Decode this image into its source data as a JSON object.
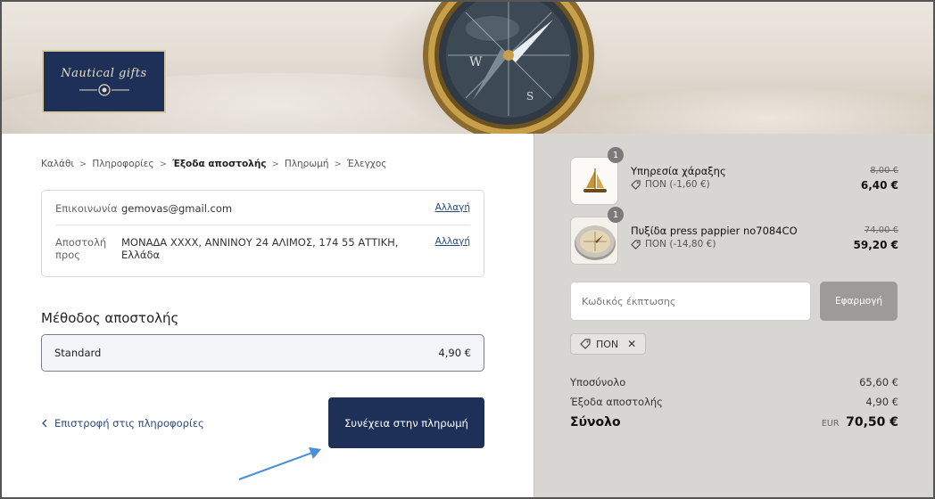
{
  "brand": {
    "logo_text": "Nautical gifts"
  },
  "breadcrumb": {
    "items": [
      "Καλάθι",
      "Πληροφορίες",
      "Έξοδα αποστολής",
      "Πληρωμή",
      "Έλεγχος"
    ],
    "separator": ">",
    "current_index": 2
  },
  "review": {
    "contact": {
      "label": "Επικοινωνία",
      "value": "gemovas@gmail.com",
      "change": "Αλλαγή"
    },
    "ship_to": {
      "label_line1": "Αποστολή",
      "label_line2": "προς",
      "value_line1": "ΜΟΝΑΔΑ ΧΧΧΧ, ΑΝΝΙΝΟΥ 24 ΑΛΙΜΟΣ, 174 55 ΑΤΤΙΚΗ,",
      "value_line2": "Ελλάδα",
      "change": "Αλλαγή"
    }
  },
  "shipping_method": {
    "heading": "Μέθοδος αποστολής",
    "option_name": "Standard",
    "option_price": "4,90 €"
  },
  "nav": {
    "back_label": "Επιστροφή στις πληροφορίες",
    "continue_label": "Συνέχεια στην πληρωμή"
  },
  "summary": {
    "items": [
      {
        "qty": "1",
        "name": "Υπηρεσία χάραξης",
        "discount": "ΠΟΝ (-1,60 €)",
        "old_price": "8,00 €",
        "price": "6,40 €",
        "icon": "sailboat-icon"
      },
      {
        "qty": "1",
        "name": "Πυξίδα press pappier no7084CO",
        "discount": "ΠΟΝ (-14,80 €)",
        "old_price": "74,00 €",
        "price": "59,20 €",
        "icon": "compass-icon"
      }
    ],
    "discount": {
      "placeholder": "Κωδικός έκπτωσης",
      "apply_label": "Εφαρμογή",
      "applied_code": "ΠΟΝ",
      "remove": "✕"
    },
    "subtotal": {
      "label": "Υποσύνολο",
      "value": "65,60 €"
    },
    "shipping": {
      "label": "Έξοδα αποστολής",
      "value": "4,90 €"
    },
    "total": {
      "label": "Σύνολο",
      "currency": "EUR",
      "value": "70,50 €"
    }
  },
  "colors": {
    "primary": "#1f3058",
    "sidebar_bg": "#d8d6d3",
    "link": "#2b4a7e",
    "annotation_arrow": "#4a90d9"
  }
}
